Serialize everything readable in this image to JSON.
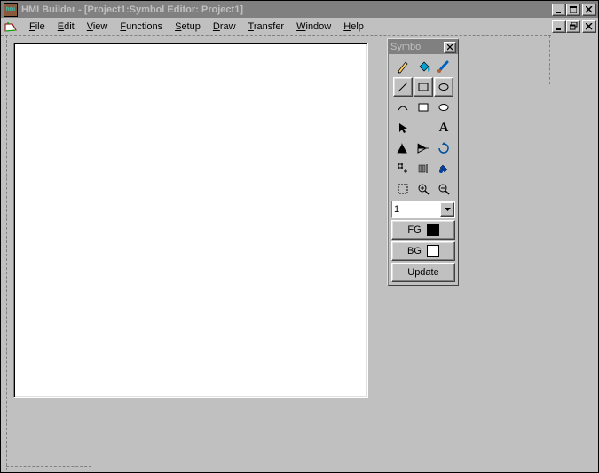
{
  "window": {
    "title": "HMI Builder - [Project1:Symbol Editor: Project1]"
  },
  "menubar": {
    "items": [
      "File",
      "Edit",
      "View",
      "Functions",
      "Setup",
      "Draw",
      "Transfer",
      "Window",
      "Help"
    ]
  },
  "palette": {
    "title": "Symbol",
    "tools": {
      "r0c0": "pencil",
      "r0c1": "paint-bucket",
      "r0c2": "brush",
      "r1c0": "line",
      "r1c1": "rectangle",
      "r1c2": "ellipse",
      "r2c0": "arc",
      "r2c1": "filled-rect",
      "r2c2": "filled-ellipse",
      "r3c0": "pointer",
      "r3c1": "blank",
      "r3c2": "text-A",
      "r4c0": "mirror-h",
      "r4c1": "mirror-v",
      "r4c2": "rotate",
      "r5c0": "snap-grid",
      "r5c1": "align",
      "r5c2": "color-swap",
      "r6c0": "select-area",
      "r6c1": "zoom-in",
      "r6c2": "zoom-out"
    },
    "zoom_value": "1",
    "fg_label": "FG",
    "fg_color": "#000000",
    "bg_label": "BG",
    "bg_color": "#ffffff",
    "update_label": "Update"
  }
}
